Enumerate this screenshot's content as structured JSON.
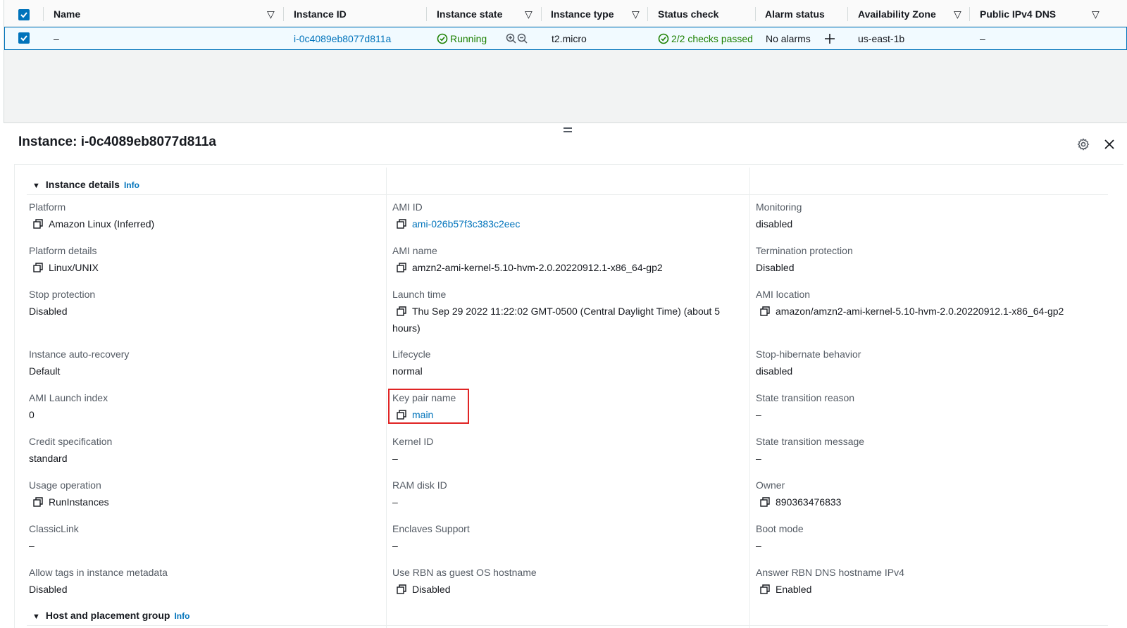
{
  "table": {
    "columns": [
      "Name",
      "Instance ID",
      "Instance state",
      "Instance type",
      "Status check",
      "Alarm status",
      "Availability Zone",
      "Public IPv4 DNS"
    ],
    "row": {
      "name": "–",
      "instance_id": "i-0c4089eb8077d811a",
      "state": "Running",
      "type": "t2.micro",
      "status_check": "2/2 checks passed",
      "alarm": "No alarms",
      "az": "us-east-1b",
      "dns": "–"
    }
  },
  "panel": {
    "title": "Instance: i-0c4089eb8077d811a",
    "sections": [
      {
        "title": "Instance details",
        "info": "Info"
      },
      {
        "title": "Host and placement group",
        "info": "Info"
      }
    ]
  },
  "fields": {
    "platform": {
      "label": "Platform",
      "value": "Amazon Linux (Inferred)"
    },
    "platform_details": {
      "label": "Platform details",
      "value": "Linux/UNIX"
    },
    "stop_protection": {
      "label": "Stop protection",
      "value": "Disabled"
    },
    "auto_recovery": {
      "label": "Instance auto-recovery",
      "value": "Default"
    },
    "ami_launch_index": {
      "label": "AMI Launch index",
      "value": "0"
    },
    "credit_spec": {
      "label": "Credit specification",
      "value": "standard"
    },
    "usage_operation": {
      "label": "Usage operation",
      "value": "RunInstances"
    },
    "classiclink": {
      "label": "ClassicLink",
      "value": "–"
    },
    "allow_tags": {
      "label": "Allow tags in instance metadata",
      "value": "Disabled"
    },
    "ami_id": {
      "label": "AMI ID",
      "value": "ami-026b57f3c383c2eec"
    },
    "ami_name": {
      "label": "AMI name",
      "value": "amzn2-ami-kernel-5.10-hvm-2.0.20220912.1-x86_64-gp2"
    },
    "launch_time": {
      "label": "Launch time",
      "value": "Thu Sep 29 2022 11:22:02 GMT-0500 (Central Daylight Time) (about 5 hours)"
    },
    "lifecycle": {
      "label": "Lifecycle",
      "value": "normal"
    },
    "key_pair": {
      "label": "Key pair name",
      "value": "main"
    },
    "kernel_id": {
      "label": "Kernel ID",
      "value": "–"
    },
    "ram_disk_id": {
      "label": "RAM disk ID",
      "value": "–"
    },
    "enclaves": {
      "label": "Enclaves Support",
      "value": "–"
    },
    "rbn_hostname": {
      "label": "Use RBN as guest OS hostname",
      "value": "Disabled"
    },
    "monitoring": {
      "label": "Monitoring",
      "value": "disabled"
    },
    "termination_protection": {
      "label": "Termination protection",
      "value": "Disabled"
    },
    "ami_location": {
      "label": "AMI location",
      "value": "amazon/amzn2-ami-kernel-5.10-hvm-2.0.20220912.1-x86_64-gp2"
    },
    "stop_hibernate": {
      "label": "Stop-hibernate behavior",
      "value": "disabled"
    },
    "state_reason": {
      "label": "State transition reason",
      "value": "–"
    },
    "state_message": {
      "label": "State transition message",
      "value": "–"
    },
    "owner": {
      "label": "Owner",
      "value": "890363476833"
    },
    "boot_mode": {
      "label": "Boot mode",
      "value": "–"
    },
    "answer_rbn": {
      "label": "Answer RBN DNS hostname IPv4",
      "value": "Enabled"
    }
  },
  "colors": {
    "link": "#0073bb",
    "success": "#1d8102",
    "highlight": "#e02424"
  }
}
